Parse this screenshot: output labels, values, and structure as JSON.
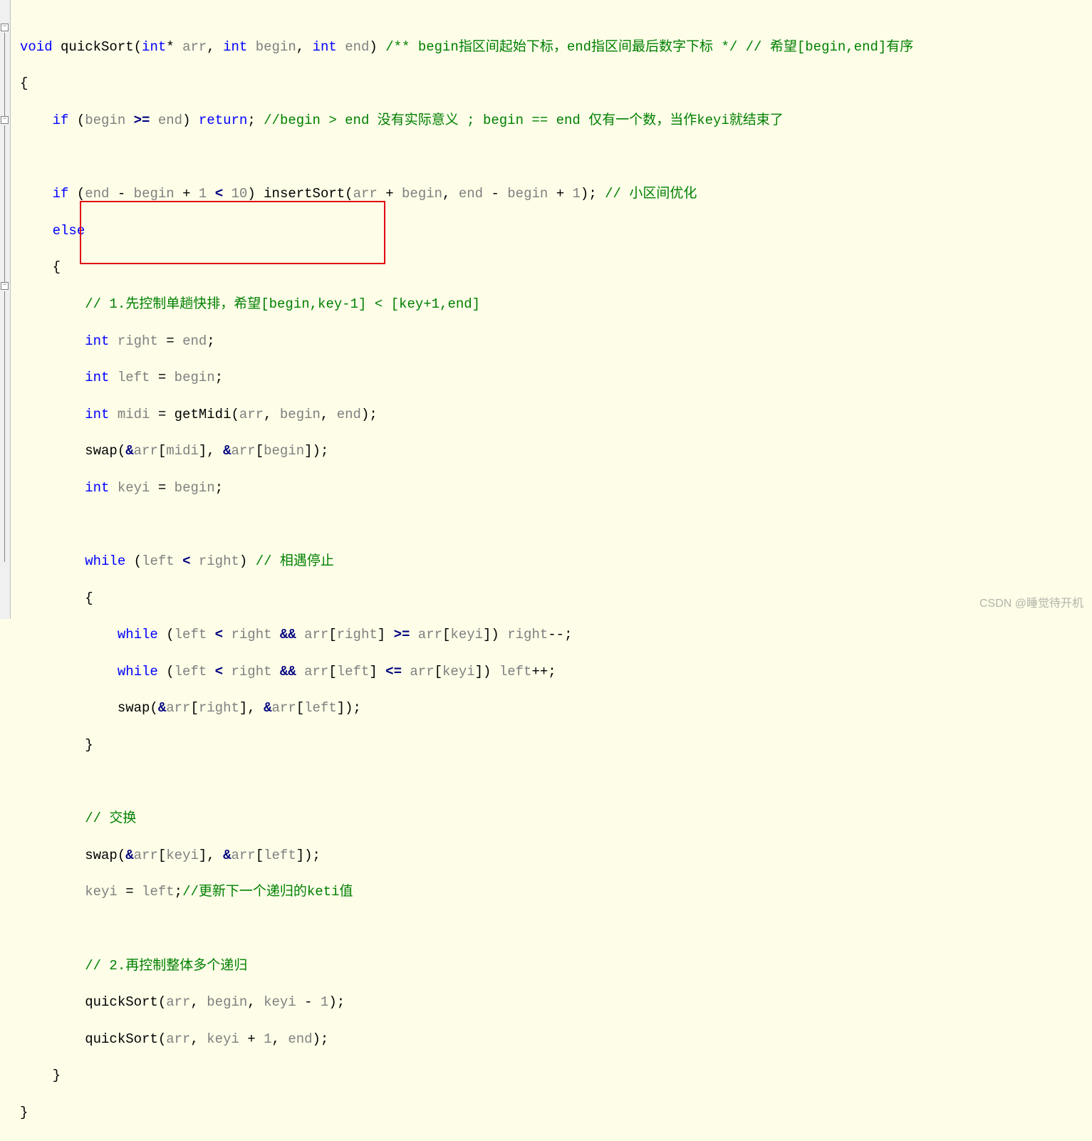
{
  "code": {
    "l1": {
      "a": "void",
      "b": " quickSort",
      "c": "(",
      "d": "int",
      "e": "* ",
      "f": "arr",
      "g": ", ",
      "h": "int",
      "i": " ",
      "j": "begin",
      "k": ", ",
      "l": "int",
      "m": " ",
      "n": "end",
      "o": ") ",
      "p": "/** begin指区间起始下标，end指区间最后数字下标 */",
      "q": " ",
      "r": "// 希望[begin,end]有序"
    },
    "l2": "{",
    "l3": {
      "a": "    ",
      "b": "if",
      "c": " (",
      "d": "begin",
      "e": " ",
      "f": ">=",
      "g": " ",
      "h": "end",
      "i": ") ",
      "j": "return",
      "k": "; ",
      "l": "//begin > end 没有实际意义 ; begin == end 仅有一个数，当作keyi就结束了"
    },
    "l4": "",
    "l5": {
      "a": "    ",
      "b": "if",
      "c": " (",
      "d": "end",
      "e": " - ",
      "f": "begin",
      "g": " + ",
      "h": "1",
      "i": " ",
      "j": "<",
      "k": " ",
      "l": "10",
      "m": ") insertSort(",
      "n": "arr",
      "o": " + ",
      "p": "begin",
      "q": ", ",
      "r": "end",
      "s": " - ",
      "t": "begin",
      "u": " + ",
      "v": "1",
      "w": "); ",
      "x": "// 小区间优化"
    },
    "l6": {
      "a": "    ",
      "b": "else"
    },
    "l7": "    {",
    "l8": {
      "a": "        ",
      "b": "// 1.先控制单趟快排，希望[begin,key-1] < [key+1,end]"
    },
    "l9": {
      "a": "        ",
      "b": "int",
      "c": " ",
      "d": "right",
      "e": " = ",
      "f": "end",
      "g": ";"
    },
    "l10": {
      "a": "        ",
      "b": "int",
      "c": " ",
      "d": "left",
      "e": " = ",
      "f": "begin",
      "g": ";"
    },
    "l11": {
      "a": "        ",
      "b": "int",
      "c": " ",
      "d": "midi",
      "e": " = getMidi(",
      "f": "arr",
      "g": ", ",
      "h": "begin",
      "i": ", ",
      "j": "end",
      "k": ");"
    },
    "l12": {
      "a": "        swap(",
      "b": "&",
      "c": "arr",
      "d": "[",
      "e": "midi",
      "f": "], ",
      "g": "&",
      "h": "arr",
      "i": "[",
      "j": "begin",
      "k": "]);"
    },
    "l13": {
      "a": "        ",
      "b": "int",
      "c": " ",
      "d": "keyi",
      "e": " = ",
      "f": "begin",
      "g": ";"
    },
    "l14": "",
    "l15": {
      "a": "        ",
      "b": "while",
      "c": " (",
      "d": "left",
      "e": " ",
      "f": "<",
      "g": " ",
      "h": "right",
      "i": ") ",
      "j": "// 相遇停止"
    },
    "l16": "        {",
    "l17": {
      "a": "            ",
      "b": "while",
      "c": " (",
      "d": "left",
      "e": " ",
      "f": "<",
      "g": " ",
      "h": "right",
      "i": " ",
      "j": "&&",
      "k": " ",
      "l": "arr",
      "m": "[",
      "n": "right",
      "o": "] ",
      "p": ">=",
      "q": " ",
      "r": "arr",
      "s": "[",
      "t": "keyi",
      "u": "]) ",
      "v": "right",
      "w": "--;"
    },
    "l18": {
      "a": "            ",
      "b": "while",
      "c": " (",
      "d": "left",
      "e": " ",
      "f": "<",
      "g": " ",
      "h": "right",
      "i": " ",
      "j": "&&",
      "k": " ",
      "l": "arr",
      "m": "[",
      "n": "left",
      "o": "] ",
      "p": "<=",
      "q": " ",
      "r": "arr",
      "s": "[",
      "t": "keyi",
      "u": "]) ",
      "v": "left",
      "w": "++;"
    },
    "l19": {
      "a": "            swap(",
      "b": "&",
      "c": "arr",
      "d": "[",
      "e": "right",
      "f": "], ",
      "g": "&",
      "h": "arr",
      "i": "[",
      "j": "left",
      "k": "]);"
    },
    "l20": "        }",
    "l21": "",
    "l22": {
      "a": "        ",
      "b": "// 交换"
    },
    "l23": {
      "a": "        swap(",
      "b": "&",
      "c": "arr",
      "d": "[",
      "e": "keyi",
      "f": "], ",
      "g": "&",
      "h": "arr",
      "i": "[",
      "j": "left",
      "k": "]);"
    },
    "l24": {
      "a": "        ",
      "b": "keyi",
      "c": " = ",
      "d": "left",
      "e": ";",
      "f": "//更新下一个递归的keti值"
    },
    "l25": "",
    "l26": {
      "a": "        ",
      "b": "// 2.再控制整体多个递归"
    },
    "l27": {
      "a": "        quickSort(",
      "b": "arr",
      "c": ", ",
      "d": "begin",
      "e": ", ",
      "f": "keyi",
      "g": " - ",
      "h": "1",
      "i": ");"
    },
    "l28": {
      "a": "        quickSort(",
      "b": "arr",
      "c": ", ",
      "d": "keyi",
      "e": " + ",
      "f": "1",
      "g": ", ",
      "h": "end",
      "i": ");"
    },
    "l29": "    }",
    "l30": "}"
  },
  "watermark": "CSDN @睡觉待开机"
}
